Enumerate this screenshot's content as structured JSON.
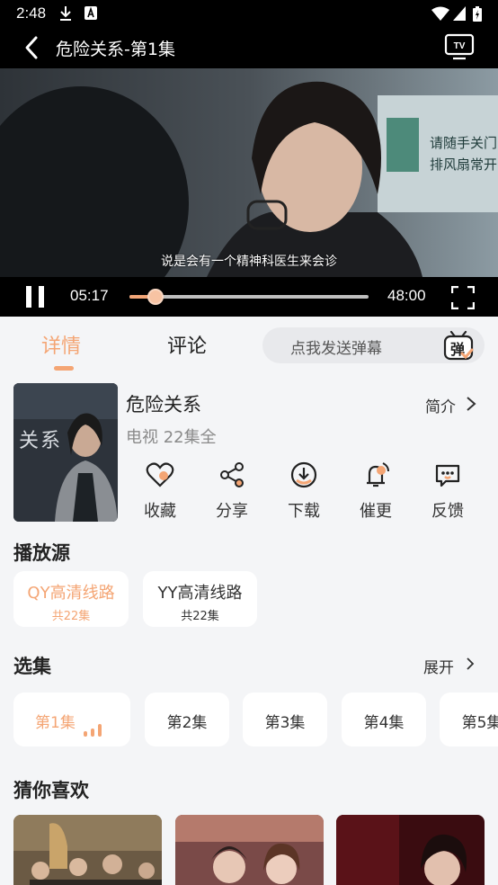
{
  "status_bar": {
    "time": "2:48"
  },
  "nav": {
    "title": "危险关系-第1集"
  },
  "player": {
    "subtitle": "说是会有一个精神科医生来会诊",
    "current_time": "05:17",
    "duration": "48:00",
    "progress": 0.11,
    "accent": "#f4a574"
  },
  "tabs": {
    "details": "详情",
    "comments": "评论",
    "danmu_placeholder": "点我发送弹幕",
    "danmu_icon_text": "弹"
  },
  "show": {
    "poster_text": "关系",
    "title": "危险关系",
    "meta": "电视 22集全",
    "intro": "简介",
    "actions": [
      {
        "label": "收藏",
        "icon": "heart-icon"
      },
      {
        "label": "分享",
        "icon": "share-icon"
      },
      {
        "label": "下载",
        "icon": "download-icon"
      },
      {
        "label": "催更",
        "icon": "bell-icon"
      },
      {
        "label": "反馈",
        "icon": "feedback-icon"
      }
    ]
  },
  "sources": {
    "title": "播放源",
    "items": [
      {
        "name": "QY高清线路",
        "count": "共22集",
        "active": true
      },
      {
        "name": "YY高清线路",
        "count": "共22集",
        "active": false
      }
    ]
  },
  "episodes": {
    "title": "选集",
    "expand": "展开",
    "items": [
      "第1集",
      "第2集",
      "第3集",
      "第4集",
      "第5集"
    ]
  },
  "recommend": {
    "title": "猜你喜欢"
  }
}
